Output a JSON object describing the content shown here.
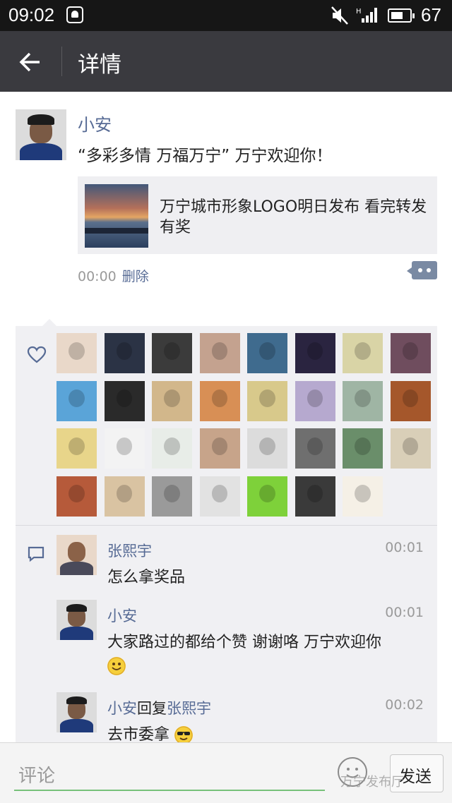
{
  "status_bar": {
    "time": "09:02",
    "signal_label": "H",
    "battery": "67",
    "battery_level": 0.67
  },
  "header": {
    "title": "详情",
    "back_icon": "back-arrow-icon"
  },
  "post": {
    "author": "小安",
    "text": "“多彩多情  万福万宁” 万宁欢迎你！",
    "link_title": "万宁城市形象LOGO明日发布 看完转发有奖",
    "time": "00:00",
    "delete_label": "删除"
  },
  "likes": {
    "icon": "heart-icon",
    "avatar_colors": [
      [
        "#e9d8c9",
        "#2b3345",
        "#3b3b3b",
        "#c4a28f",
        "#3f6b8e",
        "#2a2440",
        "#d9d4a6",
        "#6f4d5e"
      ],
      [
        "#5aa4d8",
        "#2a2a2a",
        "#d2b78b",
        "#d88f55",
        "#d8c98b",
        "#b6a9cf",
        "#9fb5a4",
        "#a5572b"
      ],
      [
        "#e8d58a",
        "#f3f3f3",
        "#e8ede8",
        "#c7a48a",
        "#dcdcdc",
        "#6f6f6f",
        "#6a8e6a",
        "#d9cfb8"
      ],
      [
        "#b65a3a",
        "#d9c3a2",
        "#9a9a9a",
        "#e2e2e2",
        "#7ed13a",
        "#3a3a3a",
        "#f5f0e6"
      ]
    ]
  },
  "comments": [
    {
      "name": "张熙宇",
      "time": "00:01",
      "text": "怎么拿奖品"
    },
    {
      "name": "小安",
      "time": "00:01",
      "text": "大家路过的都给个赞  谢谢咯 万宁欢迎你"
    },
    {
      "name": "小安",
      "reply_word": "回复",
      "reply_to": "张熙宇",
      "time": "00:02",
      "text": "去市委拿"
    }
  ],
  "comment_input": {
    "placeholder": "评论",
    "send_label": "发送"
  },
  "watermark": "万宁发布厅"
}
